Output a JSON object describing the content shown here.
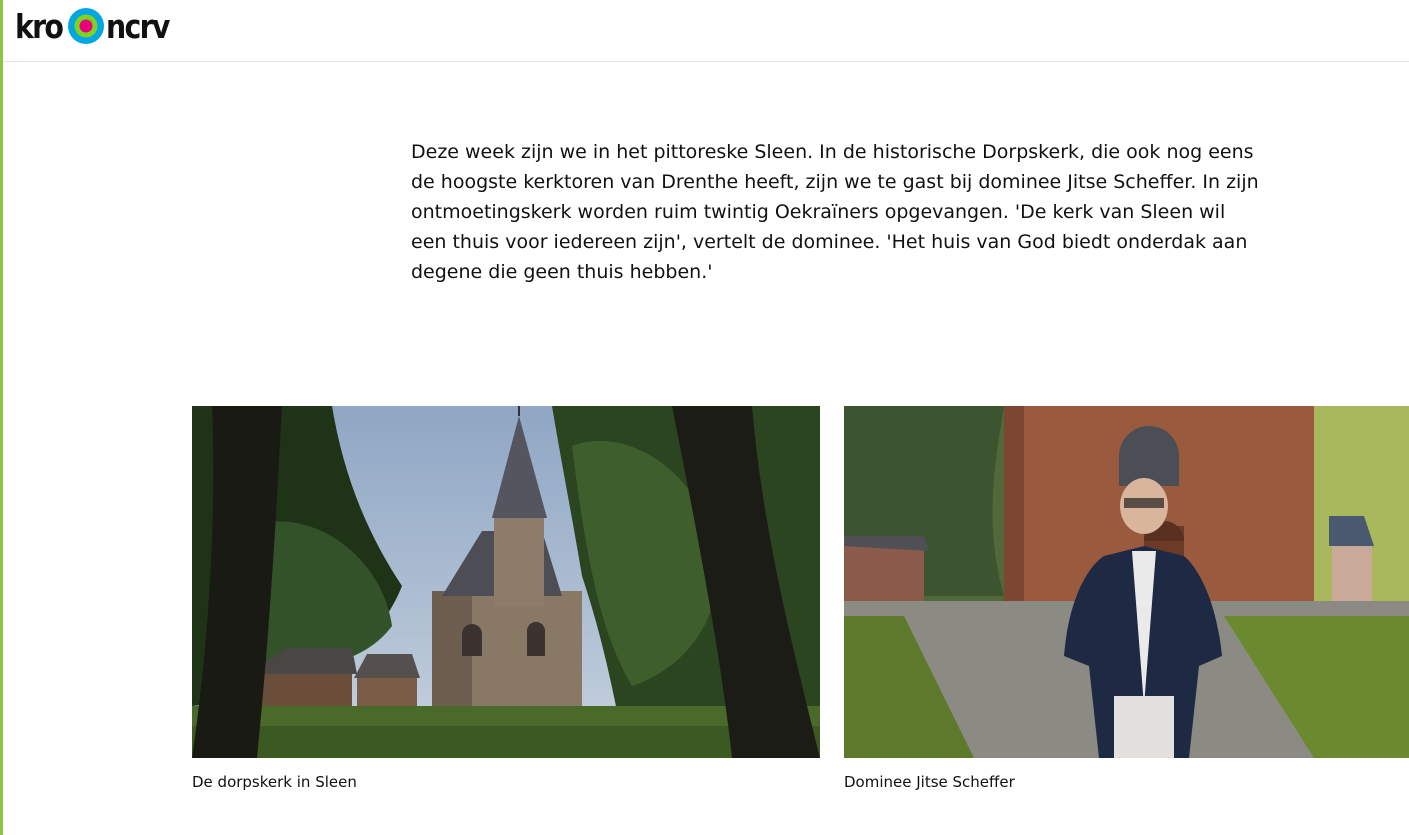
{
  "brand": {
    "logo_left": "kro",
    "logo_right": "ncrv",
    "accent_color": "#8cc63f",
    "logo_ring_colors": [
      "#00a7e1",
      "#7ed321",
      "#e6007e"
    ]
  },
  "article": {
    "intro": "Deze week zijn we in het pittoreske Sleen. In de historische Dorpskerk, die ook nog eens de hoogste kerktoren van Drenthe heeft, zijn we te gast bij dominee Jitse Scheffer. In zijn ontmoetingskerk worden ruim twintig Oekraïners opgevangen. 'De kerk van Sleen wil een thuis voor iedereen zijn', vertelt de dominee. 'Het huis van God biedt onderdak aan degene die geen thuis hebben.'"
  },
  "gallery": [
    {
      "caption": "De dorpskerk in Sleen"
    },
    {
      "caption": "Dominee Jitse Scheffer"
    }
  ]
}
